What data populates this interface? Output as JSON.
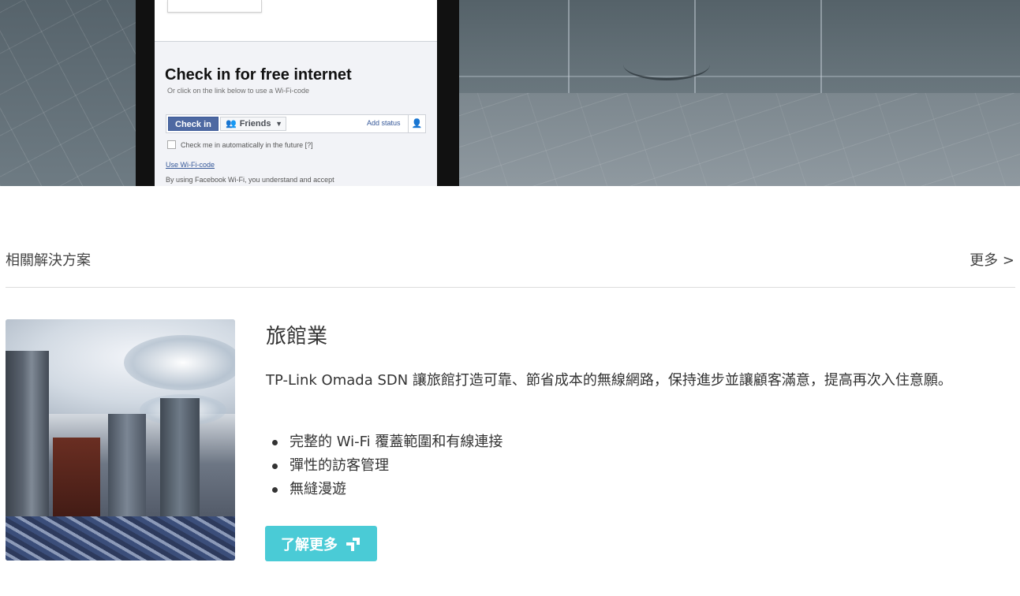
{
  "hero": {
    "facebook_wifi": {
      "title": "Check in for free internet",
      "subtitle": "Or click on the link below to use a Wi-Fi-code",
      "checkin_label": "Check in",
      "friends_label": "Friends",
      "add_status_label": "Add status",
      "auto_checkin_label": "Check me in automatically in the future [?]",
      "wifi_code_link": "Use Wi-Fi-code",
      "terms_text": "By using Facebook Wi-Fi, you understand and accept"
    }
  },
  "related": {
    "title": "相關解決方案",
    "more_label": "更多 >"
  },
  "card": {
    "title": "旅館業",
    "description": "TP-Link Omada SDN 讓旅館打造可靠、節省成本的無線網路，保持進步並讓顧客滿意，提高再次入住意願。",
    "features": [
      "完整的 Wi-Fi 覆蓋範圍和有線連接",
      "彈性的訪客管理",
      "無縫漫遊"
    ],
    "button_label": "了解更多",
    "button_color": "#4acbd6"
  }
}
